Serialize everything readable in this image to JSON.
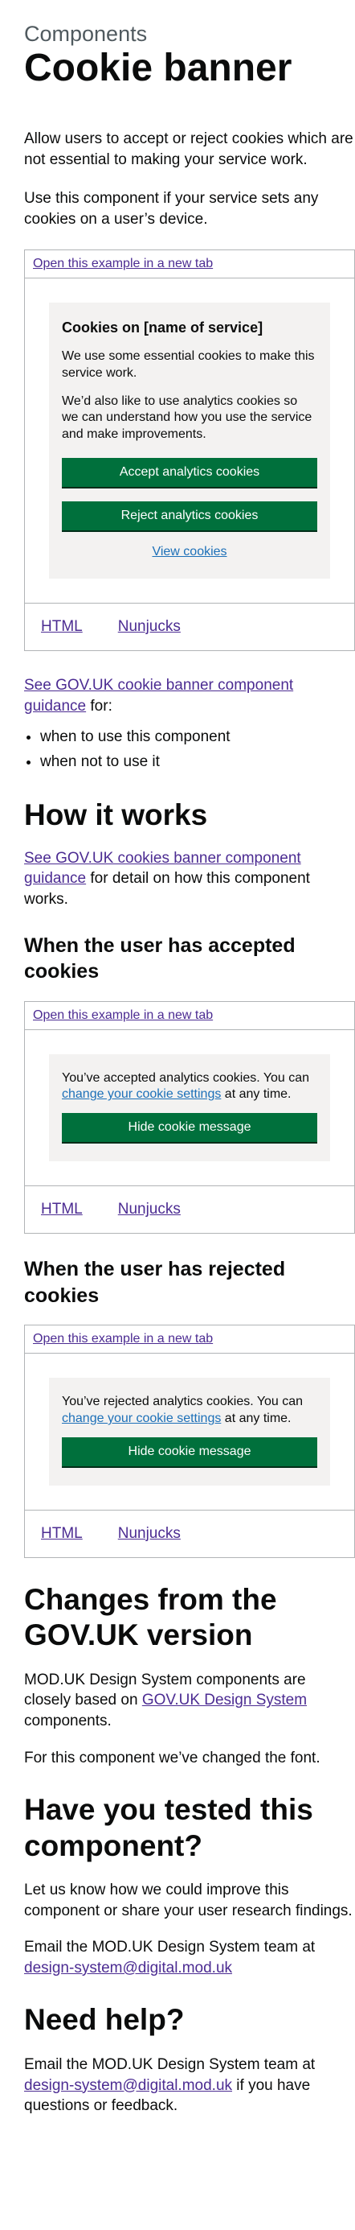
{
  "header": {
    "caption": "Components",
    "title": "Cookie banner"
  },
  "intro": {
    "p1": "Allow users to accept or reject cookies which are not essential to making your service work.",
    "p2": "Use this component if your service sets any cookies on a user’s device."
  },
  "example_main": {
    "open_link": "Open this example in a new tab",
    "banner_title": "Cookies on [name of service]",
    "banner_p1": "We use some essential cookies to make this service work.",
    "banner_p2": "We’d also like to use analytics cookies so we can understand how you use the service and make improvements.",
    "accept_label": "Accept analytics cookies",
    "reject_label": "Reject analytics cookies",
    "view_label": "View cookies",
    "tab_html": "HTML",
    "tab_nunjucks": "Nunjucks"
  },
  "guidance": {
    "link": "See GOV.UK cookie banner component guidance",
    "suffix": " for:",
    "bullets": [
      "when to use this component",
      "when not to use it"
    ]
  },
  "how_it_works": {
    "heading": "How it works",
    "link": "See GOV.UK cookies banner component guidance",
    "suffix": " for detail on how this component works."
  },
  "accepted": {
    "heading": "When the user has accepted cookies",
    "open_link": "Open this example in a new tab",
    "text_before": "You’ve accepted analytics cookies. You can ",
    "link": "change your cookie settings",
    "text_after": " at any time.",
    "hide_label": "Hide cookie message",
    "tab_html": "HTML",
    "tab_nunjucks": "Nunjucks"
  },
  "rejected": {
    "heading": "When the user has rejected cookies",
    "open_link": "Open this example in a new tab",
    "text_before": "You’ve rejected analytics cookies. You can ",
    "link": "change your cookie settings",
    "text_after": " at any time.",
    "hide_label": "Hide cookie message",
    "tab_html": "HTML",
    "tab_nunjucks": "Nunjucks"
  },
  "changes": {
    "heading": "Changes from the GOV.UK version",
    "p1_before": "MOD.UK Design System components are closely based on ",
    "p1_link": "GOV.UK Design System",
    "p1_after": " components.",
    "p2": "For this component we’ve changed the font."
  },
  "tested": {
    "heading": "Have you tested this component?",
    "p1": "Let us know how we could improve this component or share your user research findings.",
    "p2_before": "Email the MOD.UK Design System team at ",
    "p2_link": "design-system@digital.mod.uk"
  },
  "help": {
    "heading": "Need help?",
    "p_before": "Email the MOD.UK Design System team at ",
    "p_link": "design-system@digital.mod.uk",
    "p_after": " if you have questions or feedback."
  }
}
